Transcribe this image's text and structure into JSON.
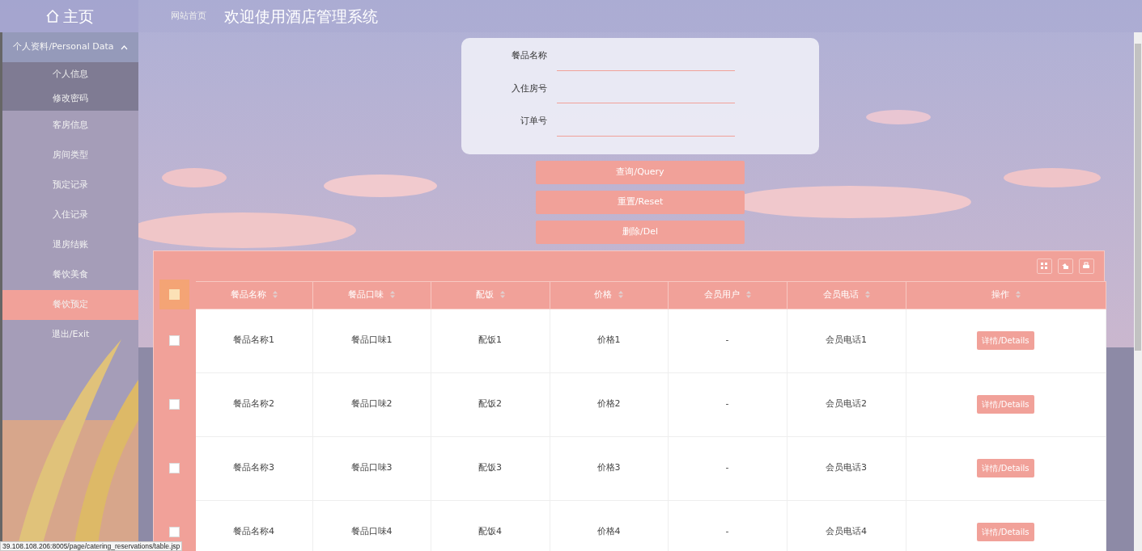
{
  "header": {
    "home": "主页",
    "breadcrumb": "网站首页",
    "title": "欢迎使用酒店管理系统"
  },
  "sidebar": {
    "items": [
      {
        "label": "个人资料/Personal Data",
        "expanded": true,
        "children": [
          {
            "label": "个人信息",
            "selected": false
          },
          {
            "label": "修改密码",
            "selected": false
          }
        ]
      },
      {
        "label": "客房信息",
        "selected": false
      },
      {
        "label": "房间类型",
        "selected": false
      },
      {
        "label": "预定记录",
        "selected": false
      },
      {
        "label": "入住记录",
        "selected": false
      },
      {
        "label": "退房结账",
        "selected": false
      },
      {
        "label": "餐饮美食",
        "selected": false
      },
      {
        "label": "餐饮预定",
        "selected": true
      },
      {
        "label": "退出/Exit",
        "selected": false
      }
    ]
  },
  "search": {
    "fields": [
      {
        "label": "餐品名称"
      },
      {
        "label": "入住房号"
      },
      {
        "label": "订单号"
      }
    ],
    "buttons": [
      "查询/Query",
      "重置/Reset",
      "删除/Del"
    ]
  },
  "table": {
    "header_checkbox": {
      "checked": false,
      "hovered": true
    },
    "columns": [
      "餐品名称",
      "餐品口味",
      "配饭",
      "价格",
      "会员用户",
      "会员电话",
      "操作"
    ],
    "rows": [
      {
        "checked": false,
        "cells": [
          "餐品名称1",
          "餐品口味1",
          "配饭1",
          "价格1",
          "-",
          "会员电话1"
        ],
        "action": "详情/Details"
      },
      {
        "checked": false,
        "cells": [
          "餐品名称2",
          "餐品口味2",
          "配饭2",
          "价格2",
          "-",
          "会员电话2"
        ],
        "action": "详情/Details"
      },
      {
        "checked": false,
        "cells": [
          "餐品名称3",
          "餐品口味3",
          "配饭3",
          "价格3",
          "-",
          "会员电话3"
        ],
        "action": "详情/Details"
      },
      {
        "checked": false,
        "cells": [
          "餐品名称4",
          "餐品口味4",
          "配饭4",
          "价格4",
          "-",
          "会员电话4"
        ],
        "action": "详情/Details"
      }
    ]
  },
  "status_bar": "39.108.108.206:8005/page/catering_reservations/table.jsp"
}
